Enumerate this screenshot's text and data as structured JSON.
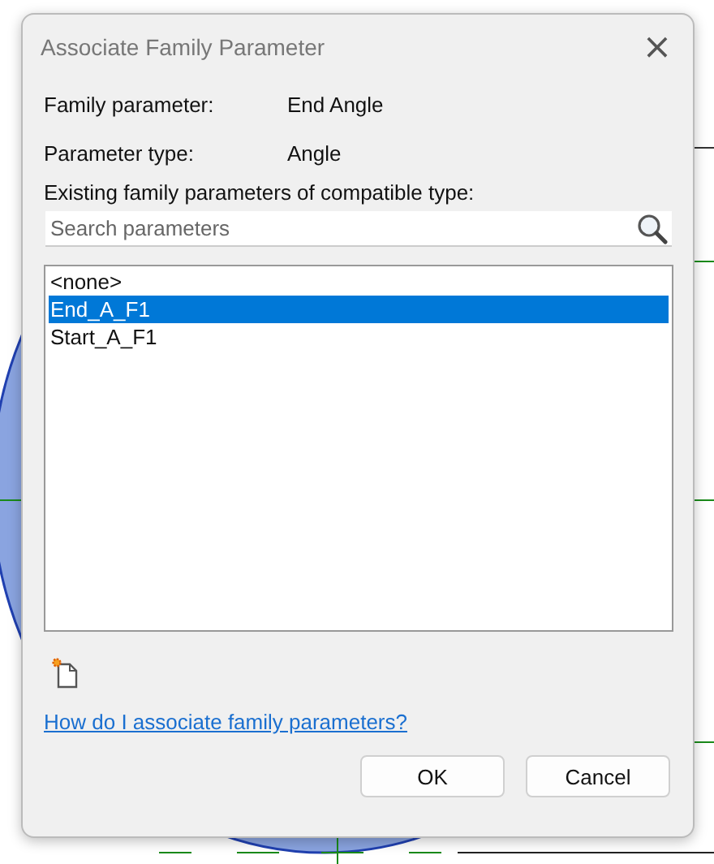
{
  "window": {
    "title": "Associate Family Parameter",
    "close": "×"
  },
  "fields": [
    {
      "label": "Family parameter:",
      "value": "End Angle"
    },
    {
      "label": "Parameter type:",
      "value": "Angle"
    }
  ],
  "list_label": "Existing family parameters of compatible type:",
  "search": {
    "placeholder": "Search parameters"
  },
  "parameters": [
    {
      "name": "<none>",
      "selected": false
    },
    {
      "name": "End_A_F1",
      "selected": true
    },
    {
      "name": "Start_A_F1",
      "selected": false
    }
  ],
  "help_link": "How do I associate family parameters?",
  "buttons": [
    "OK",
    "Cancel"
  ]
}
